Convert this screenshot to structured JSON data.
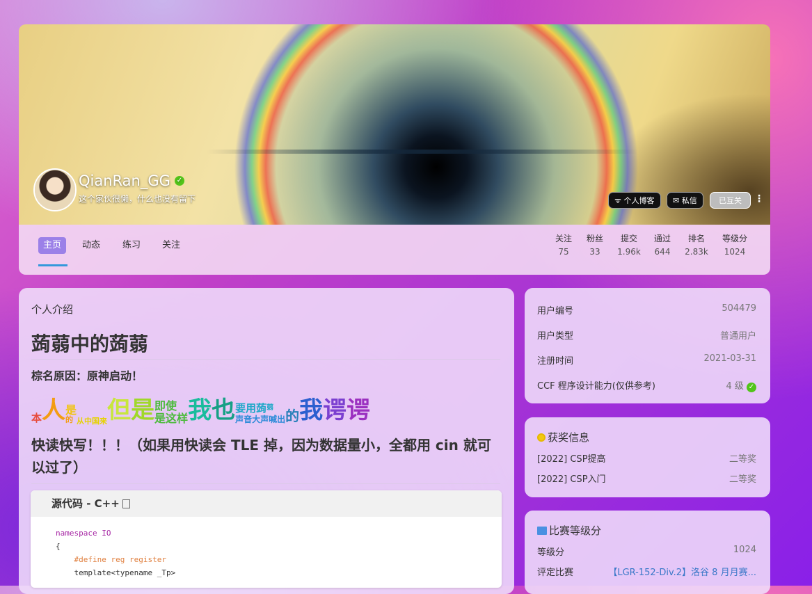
{
  "profile": {
    "username": "QianRan_GG",
    "bio": "这个家伙很懒，什么也没有留下",
    "buttons": {
      "blog": "个人博客",
      "message": "私信",
      "follow_status": "已互关"
    }
  },
  "nav": {
    "tabs": [
      "主页",
      "动态",
      "练习",
      "关注"
    ],
    "stats": [
      {
        "label": "关注",
        "value": "75"
      },
      {
        "label": "粉丝",
        "value": "33"
      },
      {
        "label": "提交",
        "value": "1.96k"
      },
      {
        "label": "通过",
        "value": "644"
      },
      {
        "label": "排名",
        "value": "2.83k"
      },
      {
        "label": "等级分",
        "value": "1024"
      }
    ]
  },
  "intro": {
    "heading": "个人介绍",
    "title": "蒟蒻中的蒟蒻",
    "reason": "棕名原因：原神启动！",
    "rainbow": [
      "本",
      "人",
      "是",
      "从",
      "中",
      "国",
      "来",
      "的",
      "但",
      "是",
      "即",
      "使",
      "是",
      "这",
      "样",
      "我",
      "也",
      "要",
      "用",
      "蒟",
      "蒻",
      "声",
      "音",
      "大",
      "声",
      "喊",
      "出",
      "的",
      "我",
      "谔",
      "谔"
    ],
    "fast_io": "快读快写！！！（如果用快读会 TLE 掉，因为数据量小，全都用 cin 就可以过了）",
    "code_title": "源代码 - C++",
    "code_lines": [
      "namespace IO",
      "{",
      "    #define reg register",
      "    template<typename _Tp>"
    ]
  },
  "info": {
    "rows": [
      {
        "label": "用户编号",
        "value": "504479"
      },
      {
        "label": "用户类型",
        "value": "普通用户"
      },
      {
        "label": "注册时间",
        "value": "2021-03-31"
      },
      {
        "label": "CCF 程序设计能力(仅供参考)",
        "value": "4 级"
      }
    ]
  },
  "awards": {
    "title": "获奖信息",
    "rows": [
      {
        "label": "[2022] CSP提高",
        "value": "二等奖"
      },
      {
        "label": "[2022] CSP入门",
        "value": "二等奖"
      }
    ]
  },
  "contest": {
    "title": "比赛等级分",
    "rows": [
      {
        "label": "等级分",
        "value": "1024"
      },
      {
        "label": "评定比赛",
        "value": "【LGR-152-Div.2】洛谷 8 月月赛..."
      }
    ]
  }
}
